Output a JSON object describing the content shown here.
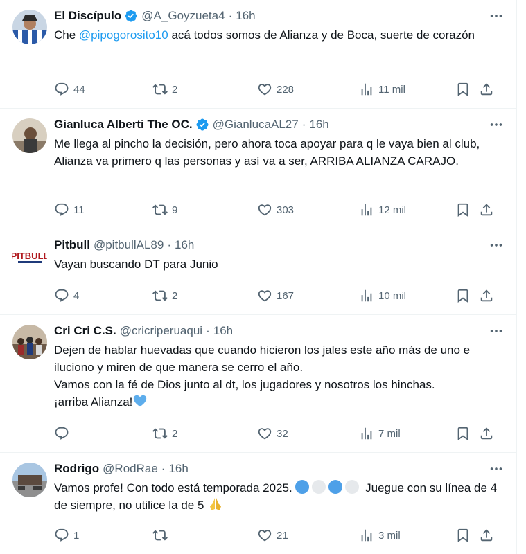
{
  "tweets": [
    {
      "name": "El Discípulo",
      "verified": true,
      "handle": "@A_Goyzueta4",
      "dot": "·",
      "time": "16h",
      "text_before": "Che ",
      "mention": "@pipogorosito10",
      "text_after": " acá todos somos de Alianza y de Boca, suerte de corazón",
      "replies": "44",
      "retweets": "2",
      "likes": "228",
      "views": "11 mil"
    },
    {
      "name": "Gianluca Alberti The OC.",
      "verified": true,
      "handle": "@GianlucaAL27",
      "dot": "·",
      "time": "16h",
      "text": "Me llega al pincho la decisión, pero ahora toca apoyar para q le vaya bien al club, Alianza va primero q las personas y así va a ser, ARRIBA ALIANZA CARAJO.",
      "replies": "11",
      "retweets": "9",
      "likes": "303",
      "views": "12 mil"
    },
    {
      "name": "Pitbull",
      "verified": false,
      "handle": "@pitbullAL89",
      "dot": "·",
      "time": "16h",
      "text": "Vayan buscando DT para Junio",
      "replies": "4",
      "retweets": "2",
      "likes": "167",
      "views": "10 mil"
    },
    {
      "name": "Cri Cri C.S.",
      "verified": false,
      "handle": "@cricriperuaqui",
      "dot": "·",
      "time": "16h",
      "text_line1": "Dejen de hablar huevadas que cuando hicieron los jales este año más de uno e iluciono y miren de que manera se cerro el año.",
      "text_line2": "Vamos con la fé de Dios junto al dt, los jugadores y nosotros los hinchas.",
      "text_line3": "¡arriba Alianza!",
      "replies": "",
      "retweets": "2",
      "likes": "32",
      "views": "7 mil"
    },
    {
      "name": "Rodrigo",
      "verified": false,
      "handle": "@RodRae",
      "dot": "·",
      "time": "16h",
      "text_before": "Vamos profe! Con todo está temporada 2025. ",
      "text_after": " Juegue con su línea de 4 de siempre, no utilice la de 5 ",
      "replies": "1",
      "retweets": "",
      "likes": "21",
      "views": "3 mil"
    }
  ],
  "icons": {
    "reply": "reply-icon",
    "retweet": "retweet-icon",
    "like": "heart-icon",
    "views": "views-icon",
    "bookmark": "bookmark-icon",
    "share": "share-icon",
    "more": "more-icon",
    "verified": "verified-badge-icon"
  },
  "colors": {
    "accent": "#1d9bf0",
    "muted": "#536471",
    "text": "#0f1419",
    "divider": "#eff3f4",
    "blue_circle": "#4ea0e8",
    "white_circle": "#e6e9ec"
  }
}
